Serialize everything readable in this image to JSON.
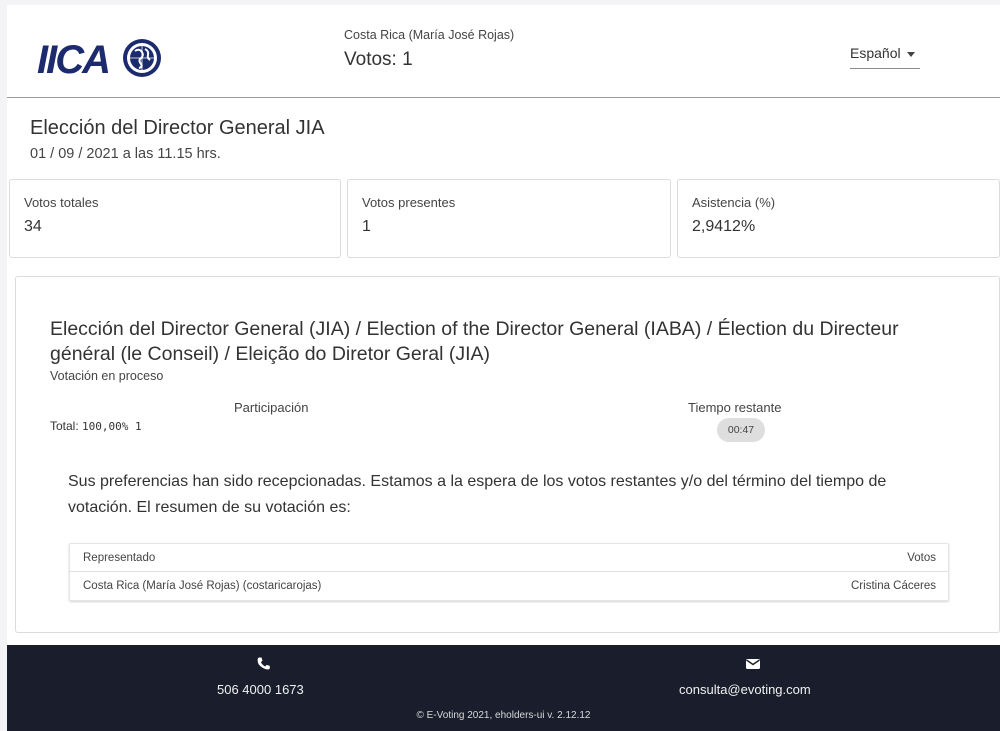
{
  "header": {
    "account_name": "Costa Rica (María José Rojas)",
    "votes_label": "Votos: 1",
    "language": "Español",
    "logo_text": "IICA"
  },
  "election": {
    "title": "Elección del Director General JIA",
    "date": "01 / 09 / 2021 a las 11.15 hrs."
  },
  "stats": [
    {
      "label": "Votos totales",
      "value": "34"
    },
    {
      "label": "Votos presentes",
      "value": "1"
    },
    {
      "label": "Asistencia (%)",
      "value": "2,9412%"
    }
  ],
  "vote": {
    "title": "Elección del Director General (JIA) / Election of the Director General (IABA) / Élection du Directeur général (le Conseil) / Eleição do Diretor Geral (JIA)",
    "status": "Votación en proceso",
    "participation_label": "Participación",
    "total_prefix": "Total:",
    "total_value": "100,00% 1",
    "time_label": "Tiempo restante",
    "time_value": "00:47",
    "confirmation": "Sus preferencias han sido recepcionadas. Estamos a la espera de los votos restantes y/o del término del tiempo de votación. El resumen de su votación es:"
  },
  "summary": {
    "columns": [
      "Representado",
      "Votos"
    ],
    "rows": [
      [
        "Costa Rica (María José Rojas) (costaricarojas)",
        "Cristina Cáceres"
      ]
    ]
  },
  "footer": {
    "phone": "506 4000 1673",
    "email": "consulta@evoting.com",
    "copyright": "© E-Voting 2021, eholders-ui v. 2.12.12"
  },
  "colors": {
    "footer_bg": "#1a1e2c",
    "logo_blue": "#1c2a6e",
    "timer_bg": "#dedede"
  },
  "icons": [
    "phone-icon",
    "mail-icon",
    "globe-seal-icon",
    "caret-down-icon"
  ]
}
